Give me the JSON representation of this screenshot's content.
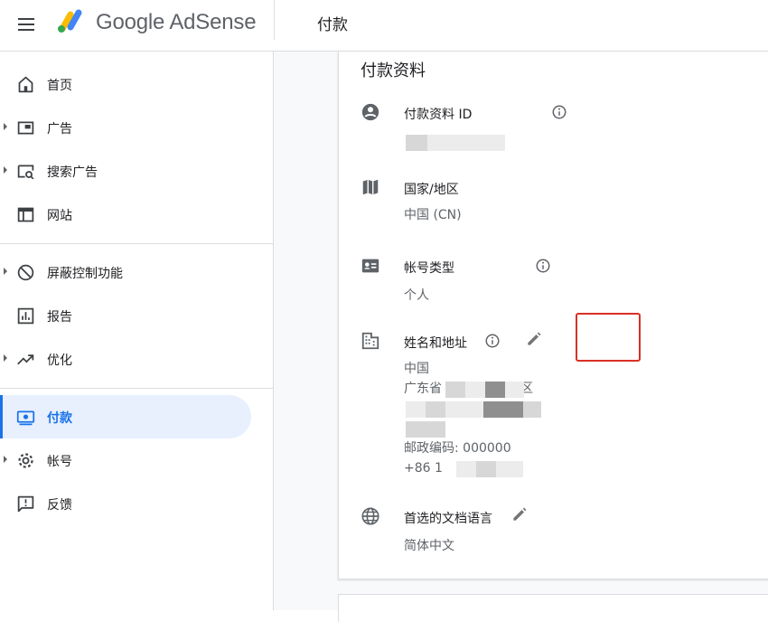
{
  "header": {
    "brand": "Google AdSense",
    "page_title": "付款",
    "icons": {
      "menu": "menu-icon",
      "logo": "adsense-logo"
    }
  },
  "sidebar": {
    "items": [
      {
        "label": "首页",
        "icon": "home-icon",
        "expandable": false,
        "active": false
      },
      {
        "label": "广告",
        "icon": "ads-icon",
        "expandable": true,
        "active": false
      },
      {
        "label": "搜索广告",
        "icon": "search-ads-icon",
        "expandable": true,
        "active": false
      },
      {
        "label": "网站",
        "icon": "sites-icon",
        "expandable": false,
        "active": false
      },
      {
        "label": "屏蔽控制功能",
        "icon": "block-icon",
        "expandable": true,
        "active": false
      },
      {
        "label": "报告",
        "icon": "reports-icon",
        "expandable": false,
        "active": false
      },
      {
        "label": "优化",
        "icon": "trending-icon",
        "expandable": true,
        "active": false
      },
      {
        "label": "付款",
        "icon": "payments-icon",
        "expandable": false,
        "active": true
      },
      {
        "label": "帐号",
        "icon": "gear-icon",
        "expandable": true,
        "active": false
      },
      {
        "label": "反馈",
        "icon": "feedback-icon",
        "expandable": false,
        "active": false
      }
    ]
  },
  "card": {
    "title": "付款资料",
    "profile_id": {
      "label": "付款资料 ID",
      "value": ""
    },
    "country": {
      "label": "国家/地区",
      "value": "中国 (CN)"
    },
    "account_type": {
      "label": "帐号类型",
      "value": "个人"
    },
    "name_address": {
      "label": "姓名和地址",
      "line1": "中国",
      "line2_prefix": "广东省",
      "line2_suffix": "区",
      "postal": "邮政编码: 000000",
      "phone_prefix": "+86 1"
    },
    "doc_language": {
      "label": "首选的文档语言",
      "value": "简体中文"
    }
  },
  "colors": {
    "accent": "#1a73e8",
    "active_bg": "#e8f0fe",
    "highlight": "#d93025",
    "divider": "#dadce0"
  }
}
